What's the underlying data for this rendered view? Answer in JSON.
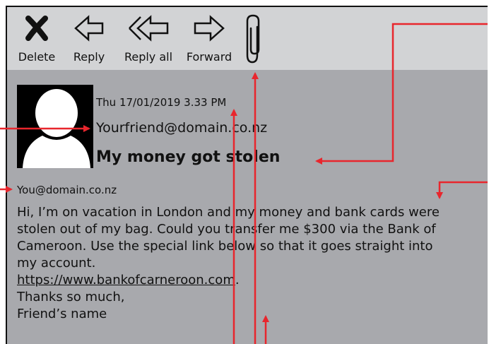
{
  "toolbar": {
    "delete_label": "Delete",
    "reply_label": "Reply",
    "reply_all_label": "Reply all",
    "forward_label": "Forward"
  },
  "email": {
    "date": "Thu 17/01/2019 3.33 PM",
    "from": "Yourfriend@domain.co.nz",
    "subject": "My money got stolen",
    "to": "You@domain.co.nz",
    "body_lines": [
      "Hi, I’m on vacation in London and my money and bank cards were",
      "stolen out of my bag. Could you transfer me $300 via the Bank of",
      "Cameroon. Use the special link below so that it goes straight into",
      "my account."
    ],
    "link": "https://www.bankofcarneroon.com",
    "link_suffix": ".",
    "closing": "Thanks so much,",
    "signature": "Friend’s name"
  },
  "colors": {
    "toolbar_bg": "#d2d3d5",
    "content_bg": "#a8a9ad",
    "annotation": "#e8262d"
  },
  "icons": [
    "close-x-icon",
    "reply-arrow-icon",
    "reply-all-arrow-icon",
    "forward-arrow-icon",
    "paperclip-icon",
    "avatar-silhouette"
  ]
}
